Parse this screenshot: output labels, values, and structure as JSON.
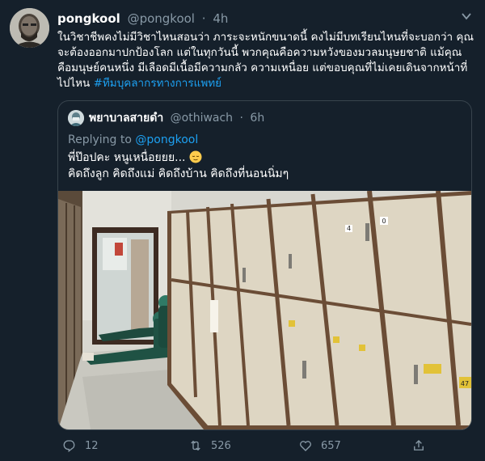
{
  "tweet": {
    "display_name": "pongkool",
    "handle": "@pongkool",
    "separator": "·",
    "time": "4h",
    "text_main": "ในวิชาชีพคงไม่มีวิชาไหนสอนว่า ภาระจะหนักขนาดนี้ คงไม่มีบทเรียนไหนที่จะบอกว่า คุณจะต้องออกมาปกป้องโลก แต่ในทุกวันนี้ พวกคุณคือความหวังของมวลมนุษยชาติ แม้คุณคือมนุษย์คนหนึ่ง มีเลือดมีเนื้อมีความกลัว ความเหนื่อย แต่ขอบคุณที่ไม่เคยเดินจากหน้าที่ไปไหน",
    "hashtag": "#ทีมบุคลากรทางการแพทย์"
  },
  "quote": {
    "display_name": "พยาบาลสายดำ",
    "handle": "@othiwach",
    "separator": "·",
    "time": "6h",
    "replying_prefix": "Replying to",
    "replying_handle": "@pongkool",
    "line1": "พี่ป๊อปคะ หนูเหนื่อยยย...",
    "line2": "คิดถึงลูก คิดถึงแม่ คิดถึงบ้าน คิดถึงที่นอนนิ่มๆ"
  },
  "photo": {
    "locker_numbers": [
      "0",
      "4",
      "47"
    ]
  },
  "actions": {
    "replies": "12",
    "retweets": "526",
    "likes": "657"
  },
  "colors": {
    "background": "#15202b",
    "text_secondary": "#8899a6",
    "accent": "#1da1f2",
    "border": "#38444d"
  }
}
